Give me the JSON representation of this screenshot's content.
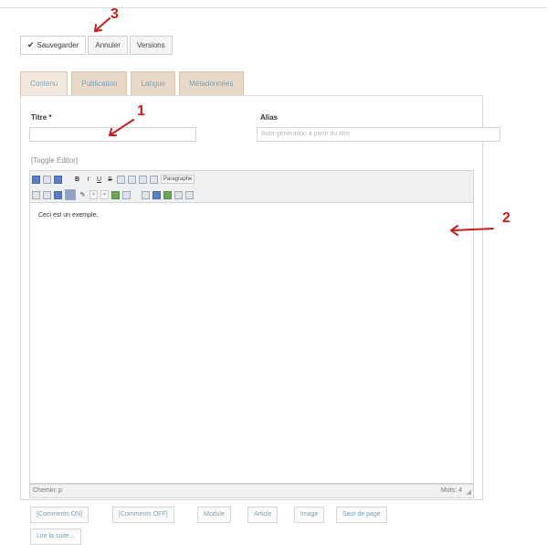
{
  "toolbar": {
    "buttons": [
      {
        "label": "Sauvegarder",
        "icon": "check-icon"
      },
      {
        "label": "Annuler"
      },
      {
        "label": "Versions"
      }
    ]
  },
  "tabs": [
    "Contenu",
    "Publication",
    "Langue",
    "Métadonnées"
  ],
  "form": {
    "title_label": "Titre *",
    "title_value": "",
    "alias_label": "Alias",
    "alias_placeholder": "Auto-génération à partir du titre"
  },
  "editor": {
    "toggle_label": "[Toggle Editor]",
    "paragraph_select": "Paragraphe",
    "content": "Ceci est un exemple.",
    "path": "Chemin: p",
    "word_count": "Mots: 4"
  },
  "extension_buttons": [
    "[Comments ON]",
    "[Comments OFF]",
    "Module",
    "Article",
    "Image",
    "Saut de page",
    "Lire la suite..."
  ],
  "annotations": {
    "one": "1",
    "two": "2",
    "three": "3",
    "color": "#c81e1e"
  }
}
